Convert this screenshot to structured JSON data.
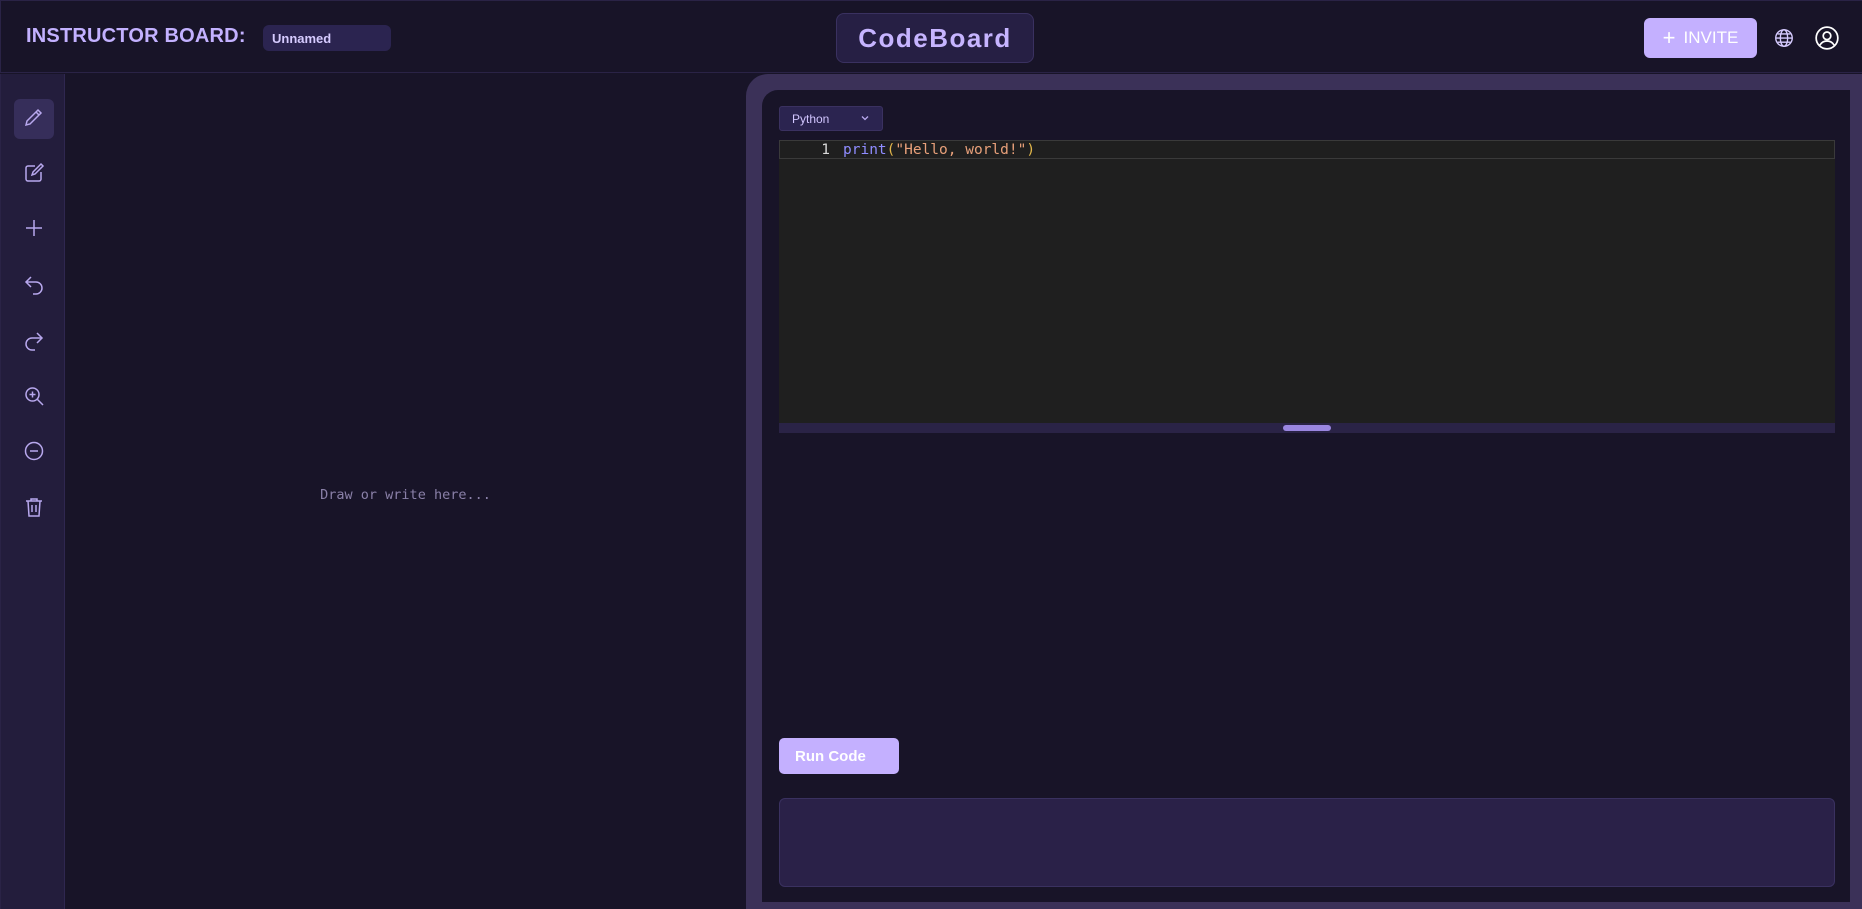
{
  "header": {
    "board_label": "INSTRUCTOR BOARD:",
    "board_name_value": "Unnamed",
    "logo_text": "CodeBoard",
    "invite_label": "INVITE",
    "invite_icon": "plus-icon",
    "language_icon": "globe-icon",
    "account_icon": "user-circle-icon"
  },
  "sidebar": {
    "tools": [
      {
        "name": "pen-tool",
        "icon": "pencil-icon",
        "active": true
      },
      {
        "name": "text-tool",
        "icon": "edit-icon",
        "active": false
      },
      {
        "name": "add-tool",
        "icon": "plus-icon",
        "active": false
      },
      {
        "name": "undo",
        "icon": "undo-icon",
        "active": false
      },
      {
        "name": "redo",
        "icon": "redo-icon",
        "active": false
      },
      {
        "name": "zoom-in",
        "icon": "zoom-in-icon",
        "active": false
      },
      {
        "name": "zoom-out",
        "icon": "minus-circle-icon",
        "active": false
      },
      {
        "name": "clear",
        "icon": "trash-icon",
        "active": false
      }
    ]
  },
  "canvas": {
    "placeholder": "Draw or write here..."
  },
  "editor": {
    "language": "Python",
    "lines": [
      {
        "number": "1",
        "fn": "print",
        "open": "(",
        "string": "\"Hello, world!\"",
        "close": ")"
      }
    ]
  },
  "run": {
    "label": "Run Code"
  },
  "output": {
    "text": ""
  },
  "colors": {
    "background": "#181428",
    "accent": "#c4b0ff",
    "panel": "#3b3158",
    "editor_bg": "#1f1f1f"
  }
}
